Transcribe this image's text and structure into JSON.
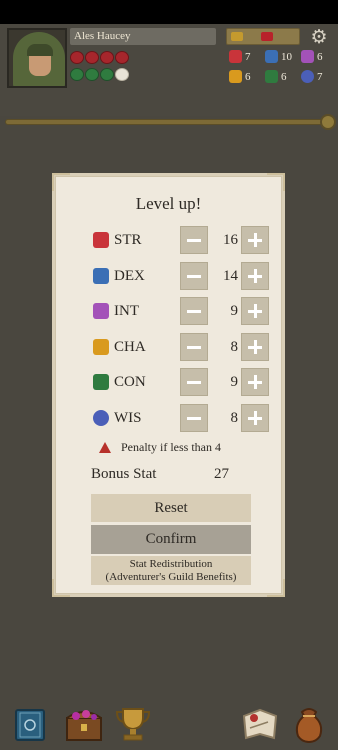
{
  "player": {
    "name": "Ales Haucey",
    "hearts_filled": 4,
    "stamina_filled": 3,
    "stamina_total": 4
  },
  "hud_stats": [
    {
      "icon": "str-icon",
      "value": "7",
      "color": "#c9343a"
    },
    {
      "icon": "dex-icon",
      "value": "10",
      "color": "#3b6fb5"
    },
    {
      "icon": "int-icon",
      "value": "6",
      "color": "#a352b8"
    },
    {
      "icon": "cha-icon",
      "value": "6",
      "color": "#d99a1e"
    },
    {
      "icon": "con-icon",
      "value": "6",
      "color": "#2f7b3f"
    },
    {
      "icon": "wis-icon",
      "value": "7",
      "color": "#4b5fb8"
    }
  ],
  "dialog": {
    "title": "Level up!",
    "stats": [
      {
        "label": "STR",
        "value": "16",
        "icon": "str-icon",
        "color": "#c9343a"
      },
      {
        "label": "DEX",
        "value": "14",
        "icon": "dex-icon",
        "color": "#3b6fb5"
      },
      {
        "label": "INT",
        "value": "9",
        "icon": "int-icon",
        "color": "#a352b8"
      },
      {
        "label": "CHA",
        "value": "8",
        "icon": "cha-icon",
        "color": "#d99a1e"
      },
      {
        "label": "CON",
        "value": "9",
        "icon": "con-icon",
        "color": "#2f7b3f"
      },
      {
        "label": "WIS",
        "value": "8",
        "icon": "wis-icon",
        "color": "#4b5fb8"
      }
    ],
    "penalty_text": "Penalty if less than 4",
    "bonus_label": "Bonus Stat",
    "bonus_value": "27",
    "reset_label": "Reset",
    "confirm_label": "Confirm",
    "redistribution_line1": "Stat Redistribution",
    "redistribution_line2": "(Adventurer's Guild Benefits)"
  },
  "bottom_bar": [
    {
      "icon": "spellbook-icon"
    },
    {
      "icon": "treasure-chest-icon"
    },
    {
      "icon": "trophy-icon"
    },
    {
      "icon": "map-scroll-icon"
    },
    {
      "icon": "inventory-bag-icon"
    }
  ],
  "colors": {
    "background": "#4a473f",
    "panel": "#efe9dd",
    "button": "#d8cdb6",
    "confirm_button": "#a7a195",
    "heart": "#a6262c",
    "stamina": "#2f7b3f"
  }
}
